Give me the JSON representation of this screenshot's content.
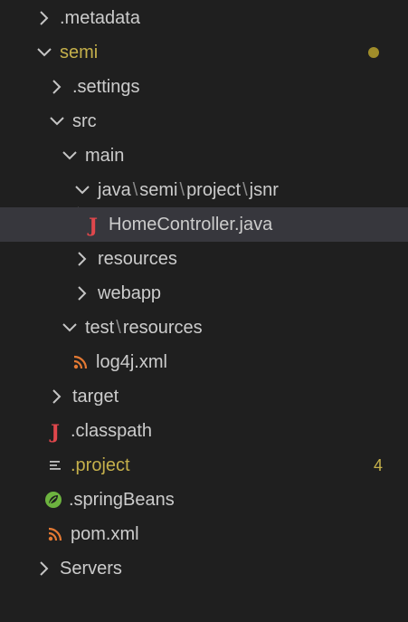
{
  "explorer": {
    "items": [
      {
        "label": ".metadata",
        "icon": "chevron-right-icon"
      },
      {
        "label": "semi",
        "icon": "chevron-down-icon",
        "status": "modified-dot"
      },
      {
        "label": ".settings",
        "icon": "chevron-right-icon"
      },
      {
        "label": "src",
        "icon": "chevron-down-icon"
      },
      {
        "label": "main",
        "icon": "chevron-down-icon"
      },
      {
        "label_parts": [
          "java",
          "semi",
          "project",
          "jsnr"
        ],
        "separator": "\\",
        "icon": "chevron-down-icon"
      },
      {
        "label": "HomeController.java",
        "icon": "java-file-icon",
        "selected": true
      },
      {
        "label": "resources",
        "icon": "chevron-right-icon"
      },
      {
        "label": "webapp",
        "icon": "chevron-right-icon"
      },
      {
        "label_parts": [
          "test",
          "resources"
        ],
        "separator": "\\",
        "icon": "chevron-down-icon"
      },
      {
        "label": "log4j.xml",
        "icon": "xml-rss-icon"
      },
      {
        "label": "target",
        "icon": "chevron-right-icon"
      },
      {
        "label": ".classpath",
        "icon": "java-file-icon"
      },
      {
        "label": ".project",
        "icon": "text-lines-icon",
        "badge": "4",
        "status": "modified"
      },
      {
        "label": ".springBeans",
        "icon": "spring-leaf-icon"
      },
      {
        "label": "pom.xml",
        "icon": "xml-rss-icon"
      },
      {
        "label": "Servers",
        "icon": "chevron-right-icon"
      }
    ]
  },
  "colors": {
    "background": "#1f1f1f",
    "selected_row": "#37373d",
    "modified_text": "#c5b04b",
    "java_icon": "#e0474c",
    "xml_icon": "#e37933",
    "spring_icon": "#6db33f"
  }
}
